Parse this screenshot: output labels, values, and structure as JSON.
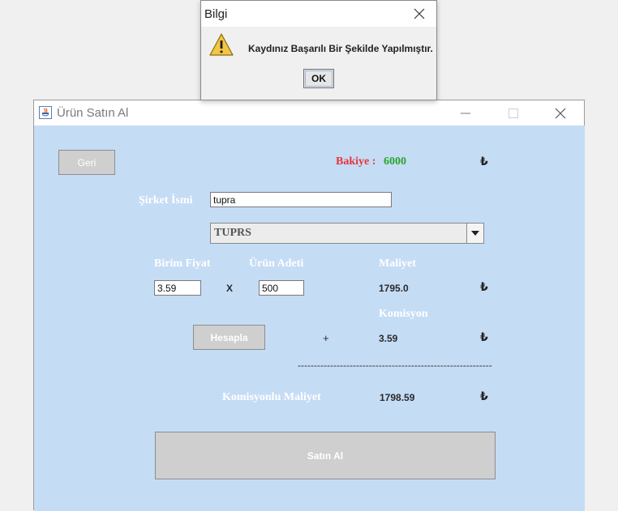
{
  "main_window": {
    "title": "Ürün Satın Al"
  },
  "toolbar": {
    "back_label": "Geri"
  },
  "balance": {
    "label": "Bakiye :",
    "value": "6000",
    "currency": "₺",
    "label_color": "#e8333a",
    "value_color": "#2aa52a"
  },
  "form": {
    "company_label": "Şirket İsmi",
    "company_value": "tupra",
    "stock_selected": "TUPRS",
    "unit_price_label": "Birim Fiyat",
    "unit_price_value": "3.59",
    "multiply_sign": "X",
    "quantity_label": "Ürün Adeti",
    "quantity_value": "500",
    "cost_label": "Maliyet",
    "cost_value": "1795.0",
    "commission_label": "Komisyon",
    "commission_value": "3.59",
    "plus_sign": "+",
    "calculate_label": "Hesapla",
    "divider": "------------------------------------------------------------",
    "total_label": "Komisyonlu Maliyet",
    "total_value": "1798.59",
    "currency": "₺",
    "buy_label": "Satın Al"
  },
  "dialog": {
    "title": "Bilgi",
    "message": "Kaydınız Başarılı Bir Şekilde Yapılmıştır.",
    "ok_label": "OK",
    "icon": "warning-icon"
  },
  "colors": {
    "content_bg": "#c5dcf5",
    "button_bg": "#cfcfcf"
  }
}
